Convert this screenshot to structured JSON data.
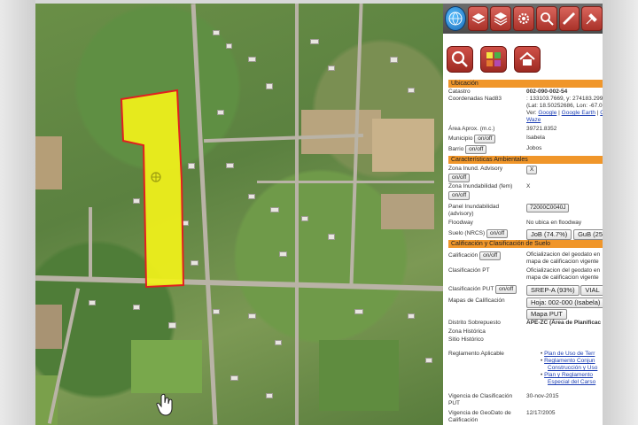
{
  "toolbar": {
    "icons": [
      "globe-icon",
      "layers-icon",
      "layers-stack-icon",
      "settings-icon",
      "search-icon",
      "measure-icon",
      "tools-icon"
    ]
  },
  "panel_icons": [
    "search-parcel-icon",
    "zoning-map-icon",
    "home-icon"
  ],
  "ubicacion": {
    "header": "Ubicación",
    "catastro_label": "Catastro",
    "catastro_value": "002-090-002-54",
    "coords_label": "Coordenadas Nad83",
    "coords_x": ": 133103.7669, y: 274183.2991",
    "coords_latlon": "(Lat: 18.50252686, Lon: -67.066",
    "ver_label": "Ver:",
    "ver_google": "Google",
    "ver_earth": "Google Earth",
    "ver_op": "Op",
    "waze": "Waze",
    "area_label": "Área Aprox. (m.c.)",
    "area_value": "39721.8352",
    "municipio_label": "Municipio",
    "municipio_value": "Isabela",
    "barrio_label": "Barrio",
    "barrio_value": "Jobos",
    "onoff": "on/off"
  },
  "ambientales": {
    "header": "Características Ambientales",
    "zona_advisory_label": "Zona Inund. Advisory",
    "zona_advisory_value": "X",
    "zona_fem_label": "Zona Inundabilidad (fem)",
    "zona_fem_value": "X",
    "panel_label": "Panel Inundabilidad",
    "panel_label2": "(advisory)",
    "panel_value": "72000C0040J",
    "floodway_label": "Floodway",
    "floodway_value": "No ubica en floodway",
    "suelo_label": "Suelo (NRCS)",
    "suelo_value1": "JoB (74.7%)",
    "suelo_value2": "GuB (25"
  },
  "calificacion": {
    "header": "Calificación y Clasificación de Suelo",
    "calif_label": "Calificación",
    "calif_value1": "Oficializacion del geodato en",
    "calif_value2": "mapa de calificacion vigente",
    "clasif_pt_label": "Clasificación PT",
    "clasif_pt_value1": "Oficializacion del geodato en",
    "clasif_pt_value2": "mapa de calificacion vigente",
    "clasif_put_label": "Clasificación PUT",
    "clasif_put_value1": "SREP-A (93%)",
    "clasif_put_value2": "VIAL",
    "mapas_label": "Mapas de Calificación",
    "mapas_value1": "Hoja: 002-000 (Isabela)",
    "mapas_value2": "Mapa PUT",
    "distrito_label": "Distrito Sobrepuesto",
    "distrito_value": "APE-ZC (Área de Planificac",
    "zona_hist_label": "Zona Histórica",
    "sitio_hist_label": "Sitio Histórico",
    "reglamento_label": "Reglamento Aplicable",
    "reg1a": "Plan de Uso de Terr",
    "reg2a": "Reglamento Conjun",
    "reg2b": "Construcción y Uso",
    "reg3a": "Plan y Reglamento",
    "reg3b": "Especial del Carso",
    "vigencia_label": "Vigencia de Clasificación",
    "vigencia_label2": "PUT",
    "vigencia_value": "30-nov-2015",
    "vig_geo_label": "Vigencia de GeoDato de",
    "vig_geo_label2": "Calificación",
    "vig_geo_value": "12/17/2005"
  },
  "colors": {
    "section_orange": "#f0962a",
    "parcel_fill": "#f2f21a",
    "parcel_border": "#e02020",
    "toolbar_red": "#b83a30"
  }
}
